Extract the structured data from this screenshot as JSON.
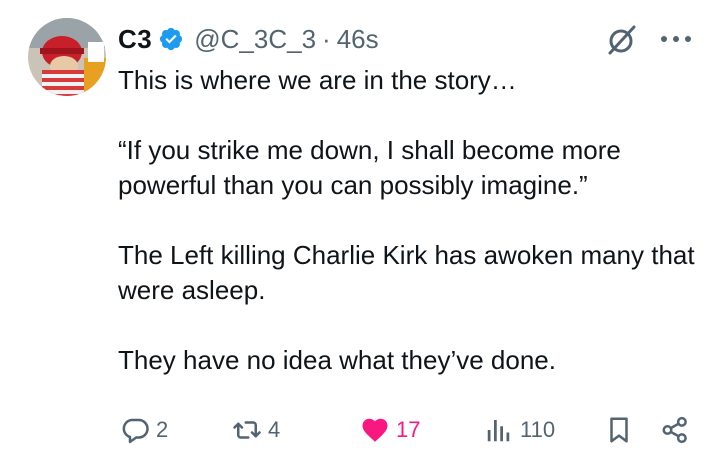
{
  "author": {
    "display_name": "C3",
    "handle": "@C_3C_3",
    "separator": "·",
    "timestamp": "46s",
    "verified": true
  },
  "tweet": {
    "paragraphs": [
      "This is where we are in the story…",
      "“If you strike me down, I shall become more powerful than you can possibly imagine.”",
      "The Left killing Charlie Kirk has awoken many that were asleep.",
      "They have no idea what they’ve done."
    ]
  },
  "actions": {
    "replies": "2",
    "reposts": "4",
    "likes": "17",
    "views": "110"
  },
  "icons": {
    "reply": "reply-icon",
    "repost": "repost-icon",
    "like": "heart-icon",
    "views": "views-icon",
    "bookmark": "bookmark-icon",
    "share": "share-icon",
    "grok": "grok-icon",
    "more": "more-icon",
    "verified": "verified-badge-icon"
  },
  "colors": {
    "verified_blue": "#1d9bf0",
    "like_pink": "#f91880",
    "muted_gray": "#536471",
    "text": "#0f1419"
  }
}
